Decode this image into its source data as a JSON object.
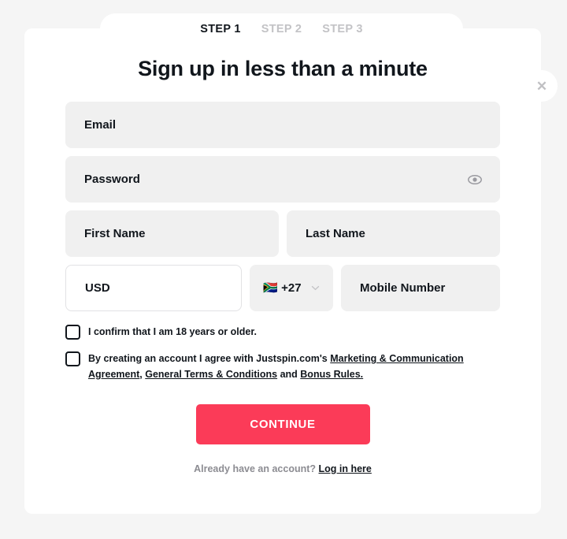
{
  "steps": [
    {
      "label": "STEP 1",
      "active": true
    },
    {
      "label": "STEP 2",
      "active": false
    },
    {
      "label": "STEP 3",
      "active": false
    }
  ],
  "close_label": "✕",
  "title": "Sign up in less than a minute",
  "fields": {
    "email": {
      "label": "Email",
      "value": ""
    },
    "password": {
      "label": "Password",
      "value": ""
    },
    "first_name": {
      "label": "First Name",
      "value": ""
    },
    "last_name": {
      "label": "Last Name",
      "value": ""
    },
    "currency": {
      "label": "USD",
      "value": "USD"
    },
    "country_code": {
      "flag": "🇿🇦",
      "dial": "+27"
    },
    "mobile": {
      "label": "Mobile Number",
      "value": ""
    }
  },
  "checkboxes": {
    "age": {
      "checked": false,
      "text": "I confirm that I am 18 years or older."
    },
    "terms": {
      "checked": false,
      "prefix": "By creating an account I agree with Justspin.com's ",
      "link1": "Marketing & Communication Agreement",
      "separator1": ", ",
      "link2": "General Terms & Conditions",
      "separator2": " and ",
      "link3": "Bonus Rules."
    }
  },
  "continue_label": "CONTINUE",
  "footer": {
    "text": "Already have an account? ",
    "link": "Log in here"
  },
  "colors": {
    "accent": "#fb3b58",
    "page_bg": "#f5f5f5",
    "card_bg": "#ffffff",
    "field_bg": "#f0f0f0",
    "text": "#11161c",
    "muted": "#c3c3c6"
  }
}
